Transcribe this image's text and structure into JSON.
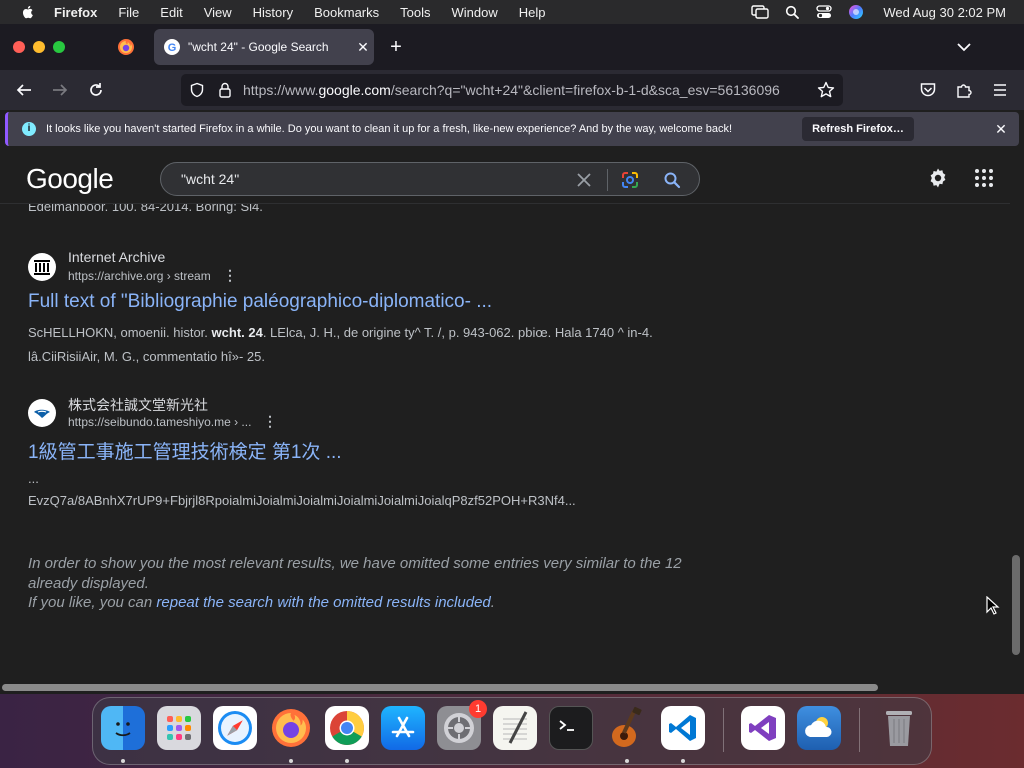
{
  "menubar": {
    "app_name": "Firefox",
    "items": [
      "File",
      "Edit",
      "View",
      "History",
      "Bookmarks",
      "Tools",
      "Window",
      "Help"
    ],
    "clock": "Wed Aug 30  2:02 PM"
  },
  "browser": {
    "active_tab_title": "\"wcht 24\" - Google Search",
    "url_prefix": "https://www.",
    "url_domain": "google.com",
    "url_rest": "/search?q=\"wcht+24\"&client=firefox-b-1-d&sca_esv=56136096",
    "notification": {
      "message": "It looks like you haven't started Firefox in a while. Do you want to clean it up for a fresh, like-new experience? And by the way, welcome back!",
      "button": "Refresh Firefox…"
    }
  },
  "google": {
    "logo": "Google",
    "query": "\"wcht 24\"",
    "cut_text": "Edelmanboor. 100. 84-2014. Boring: Si4.",
    "results": [
      {
        "site_name": "Internet Archive",
        "site_url": "https://archive.org › stream",
        "title": "Full text of \"Bibliographie paléographico-diplomatico- ...",
        "snippet_pre": "ScHELLHOKN, omoenii. histor. ",
        "snippet_bold": "wcht. 24",
        "snippet_post": ". LElca, J. H., de origine ty^ T. /, p. 943-062. pbiœ. Hala 1740 ^ in-4. lâ.CiiRisiiAir, M. G., commentatio hî»- 25."
      },
      {
        "site_name": "株式会社誠文堂新光社",
        "site_url": "https://seibundo.tameshiyo.me › ...",
        "title": "1級管工事施工管理技術検定 第1次 ...",
        "snippet_line1": "...",
        "snippet_line2": "EvzQ7a/8ABnhX7rUP9+Fbjrjl8RpoialmiJoialmiJoialmiJoialmiJoialmiJoialqP8zf52POH+R3Nf4..."
      }
    ],
    "omitted": {
      "line1": "In order to show you the most relevant results, we have omitted some entries very similar to the 12 already displayed.",
      "line2_pre": "If you like, you can ",
      "link": "repeat the search with the omitted results included",
      "line2_post": "."
    }
  },
  "dock": {
    "apps": [
      "finder-icon",
      "launchpad-icon",
      "safari-icon",
      "firefox-icon",
      "chrome-icon",
      "app-store-icon",
      "system-settings-icon",
      "textedit-icon",
      "terminal-icon",
      "garageband-icon",
      "vscode-icon",
      "visual-studio-icon",
      "weather-icon",
      "trash-icon"
    ],
    "settings_badge": "1"
  },
  "colors": {
    "link": "#8ab4f8",
    "page_bg": "#1f1f1f",
    "accent": "#9059ff"
  }
}
